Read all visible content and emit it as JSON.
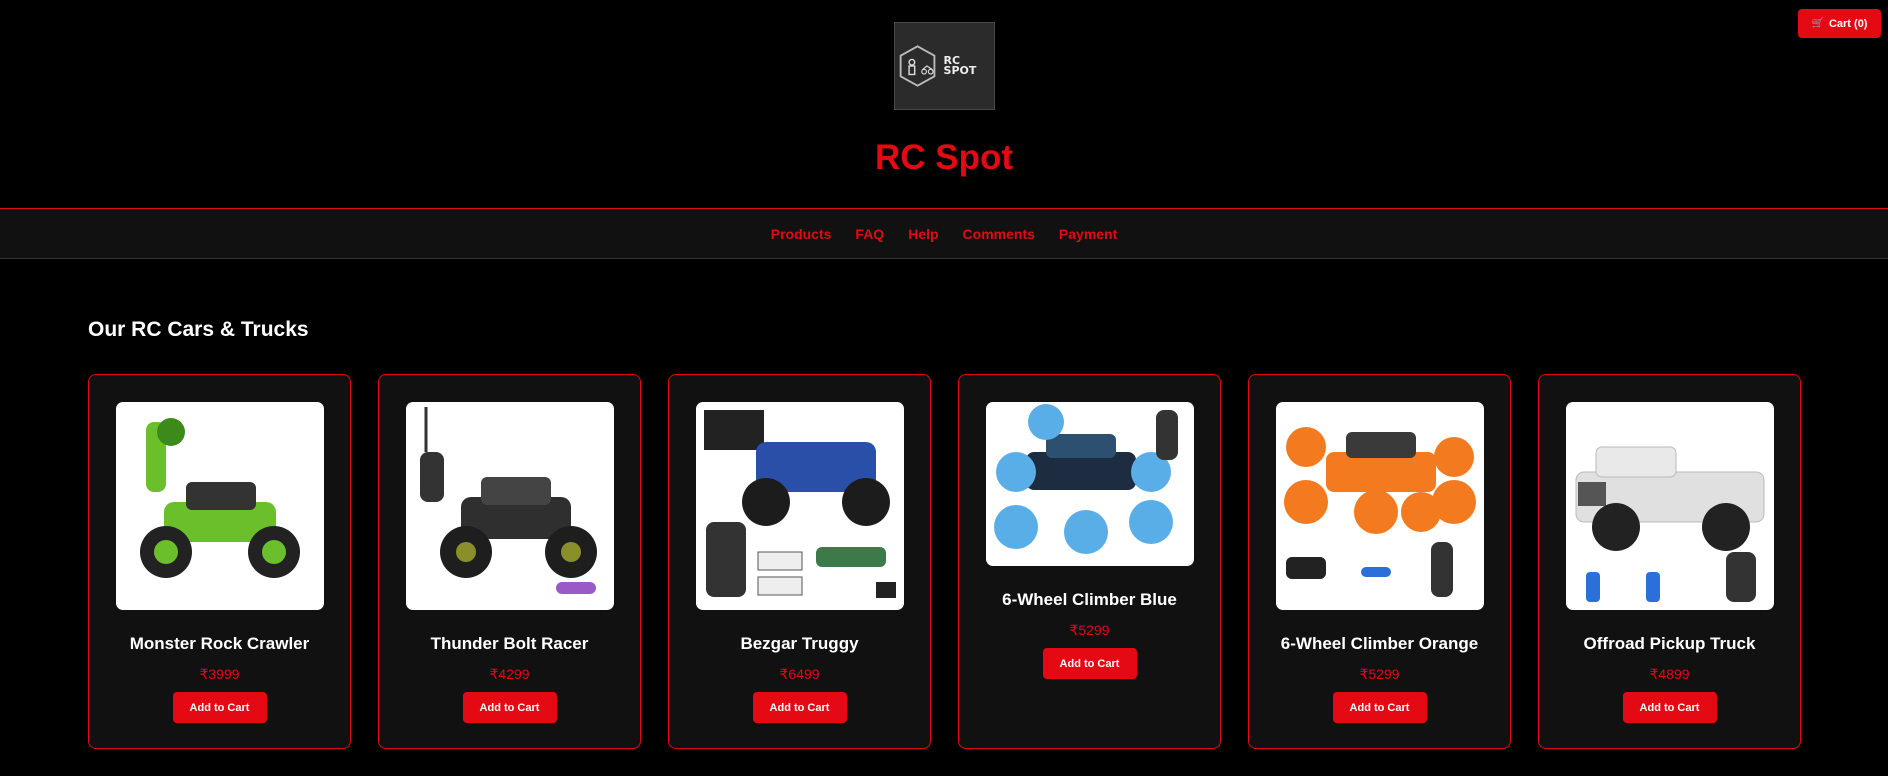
{
  "header": {
    "cart_icon": "cart-icon",
    "cart_label": "Cart (0)",
    "logo_text": "RC SPOT",
    "brand_title": "RC Spot"
  },
  "nav": {
    "items": [
      "Products",
      "FAQ",
      "Help",
      "Comments",
      "Payment"
    ]
  },
  "section": {
    "title": "Our RC Cars & Trucks"
  },
  "products": [
    {
      "name": "Monster Rock Crawler",
      "price": "₹3999",
      "button": "Add to Cart",
      "color": "#6bbf2a"
    },
    {
      "name": "Thunder Bolt Racer",
      "price": "₹4299",
      "button": "Add to Cart",
      "color": "#3a3a3a"
    },
    {
      "name": "Bezgar Truggy",
      "price": "₹6499",
      "button": "Add to Cart",
      "color": "#2a4fa8"
    },
    {
      "name": "6-Wheel Climber Blue",
      "price": "₹5299",
      "button": "Add to Cart",
      "color": "#5aaee8"
    },
    {
      "name": "6-Wheel Climber Orange",
      "price": "₹5299",
      "button": "Add to Cart",
      "color": "#f47a1f"
    },
    {
      "name": "Offroad Pickup Truck",
      "price": "₹4899",
      "button": "Add to Cart",
      "color": "#e9e9e9"
    }
  ],
  "colors": {
    "accent": "#e50914",
    "background": "#000000",
    "card": "#111111"
  }
}
